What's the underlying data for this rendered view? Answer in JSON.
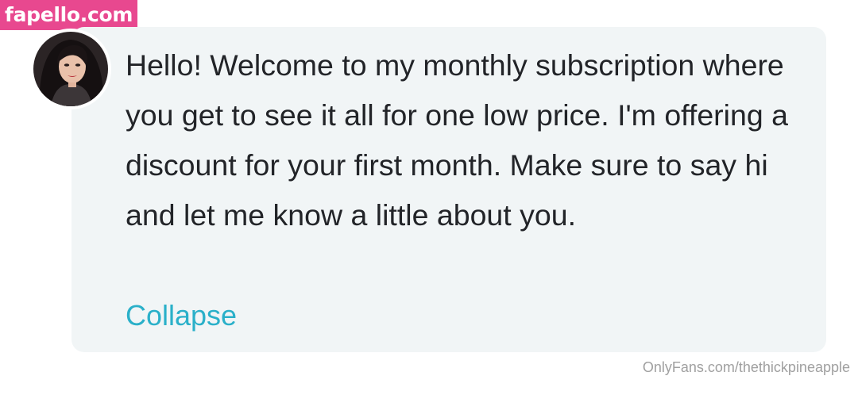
{
  "watermark": {
    "text": "fapello.com"
  },
  "post": {
    "avatar_icon": "profile-photo-woman-dark-hair",
    "message": "Hello! Welcome to my monthly subscription where you get to see it all for one low price. I'm offering a discount for your first month. Make sure to say hi and let me know a little about you.",
    "collapse_label": "Collapse"
  },
  "footer": {
    "source": "OnlyFans.com/thethickpineapple"
  },
  "colors": {
    "watermark_bg": "#e8488f",
    "bubble_bg": "#f1f5f6",
    "text": "#222428",
    "link": "#2ab0c9",
    "footer_text": "#a0a0a0"
  }
}
